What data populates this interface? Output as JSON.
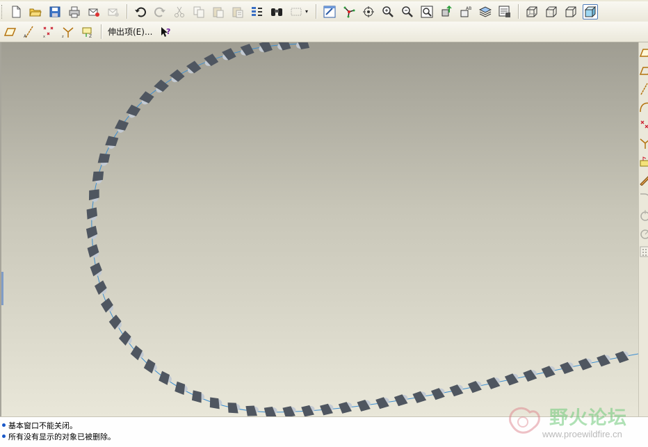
{
  "toolbar": {
    "row1": [
      {
        "name": "new-file-icon",
        "tip": "New"
      },
      {
        "name": "open-folder-icon",
        "tip": "Open"
      },
      {
        "name": "save-icon",
        "tip": "Save"
      },
      {
        "name": "print-icon",
        "tip": "Print"
      },
      {
        "name": "email-icon",
        "tip": "Send mail"
      },
      {
        "name": "email-link-icon",
        "tip": "Send link"
      },
      {
        "name": "undo-icon",
        "tip": "Undo"
      },
      {
        "name": "redo-icon",
        "tip": "Redo"
      },
      {
        "name": "cut-icon",
        "tip": "Cut"
      },
      {
        "name": "copy-icon",
        "tip": "Copy"
      },
      {
        "name": "paste-icon",
        "tip": "Paste"
      },
      {
        "name": "paste-special-icon",
        "tip": "Paste special"
      },
      {
        "name": "regenerate-icon",
        "tip": "Regenerate"
      },
      {
        "name": "find-icon",
        "tip": "Find"
      },
      {
        "name": "select-box-icon",
        "tip": "Select"
      },
      {
        "name": "repaint-icon",
        "tip": "Repaint"
      },
      {
        "name": "spin-center-icon",
        "tip": "Spin center"
      },
      {
        "name": "orient-mode-icon",
        "tip": "Orient mode"
      },
      {
        "name": "zoom-in-icon",
        "tip": "Zoom in"
      },
      {
        "name": "zoom-out-icon",
        "tip": "Zoom out"
      },
      {
        "name": "refit-icon",
        "tip": "Refit"
      },
      {
        "name": "reorient-icon",
        "tip": "Reorient"
      },
      {
        "name": "saved-views-icon",
        "tip": "Saved views"
      },
      {
        "name": "layers-icon",
        "tip": "Layers"
      },
      {
        "name": "view-manager-icon",
        "tip": "View manager"
      },
      {
        "name": "wireframe-icon",
        "tip": "Wireframe"
      },
      {
        "name": "hidden-line-icon",
        "tip": "Hidden line"
      },
      {
        "name": "no-hidden-icon",
        "tip": "No hidden"
      },
      {
        "name": "shading-icon",
        "tip": "Shading"
      }
    ],
    "row2": {
      "extrude_label": "伸出项(E)...",
      "context_help_icon": "context-help-icon"
    }
  },
  "right_toolbar": [
    "datum-plane-icon",
    "sketch-plane-icon",
    "datum-axis-icon",
    "datum-curve-icon",
    "datum-point-icon",
    "coordinate-system-icon",
    "analysis-icon",
    "sketch-tool-icon",
    "round-icon",
    "revolve-icon",
    "sweep-icon",
    "pattern-icon"
  ],
  "messages": [
    "基本窗口不能关闭。",
    "所有没有显示的对象已被删除。"
  ],
  "watermark": {
    "title": "野火论坛",
    "url": "www.proewildfire.cn"
  },
  "colors": {
    "viewport_top": "#9f9d92",
    "viewport_bottom": "#e9e7d9",
    "link_dark": "#4f5660",
    "link_light": "#c3cad3",
    "path_line": "#3b8ed2",
    "accent": "#1a58c8"
  }
}
